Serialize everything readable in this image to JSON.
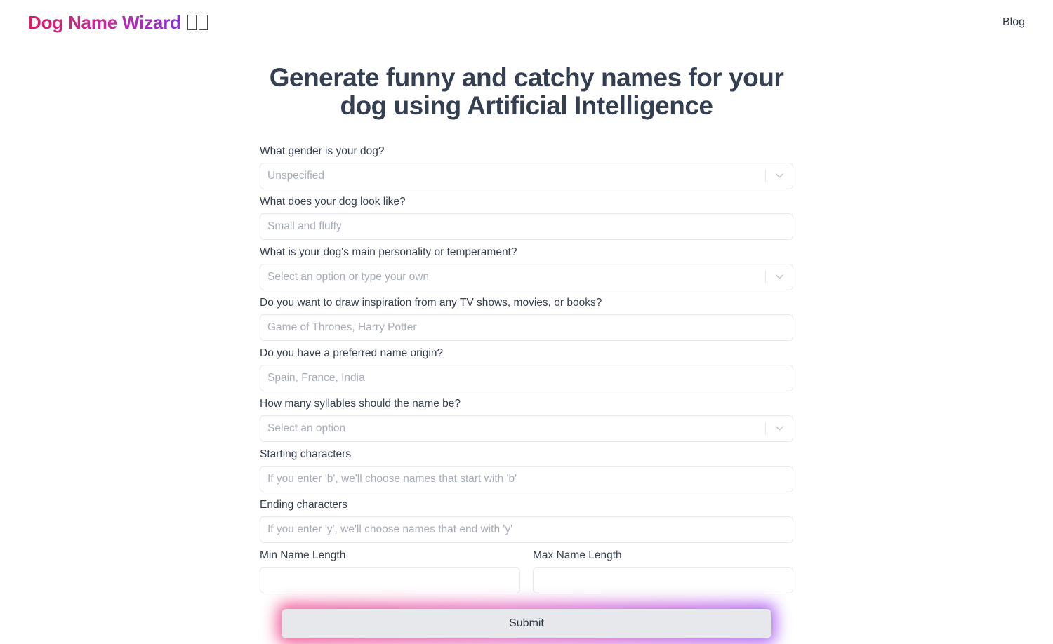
{
  "header": {
    "brand_text": "Dog Name Wizard",
    "brand_emoji_fallback": "░░",
    "nav": [
      {
        "label": "Blog"
      }
    ]
  },
  "main": {
    "title": "Generate funny and catchy names for your dog using Artificial Intelligence",
    "form": {
      "fields": [
        {
          "id": "gender",
          "label": "What gender is your dog?",
          "type": "select",
          "value": "Unspecified",
          "is_placeholder": true
        },
        {
          "id": "appearance",
          "label": "What does your dog look like?",
          "type": "text",
          "value": "",
          "placeholder": "Small and fluffy"
        },
        {
          "id": "personality",
          "label": "What is your dog's main personality or temperament?",
          "type": "select",
          "value": "Select an option or type your own",
          "is_placeholder": true
        },
        {
          "id": "inspiration",
          "label": "Do you want to draw inspiration from any TV shows, movies, or books?",
          "type": "text",
          "value": "",
          "placeholder": "Game of Thrones, Harry Potter"
        },
        {
          "id": "origin",
          "label": "Do you have a preferred name origin?",
          "type": "text",
          "value": "",
          "placeholder": "Spain, France, India"
        },
        {
          "id": "syllables",
          "label": "How many syllables should the name be?",
          "type": "select",
          "value": "Select an option",
          "is_placeholder": true
        },
        {
          "id": "starting_characters",
          "label": "Starting characters",
          "type": "text",
          "value": "",
          "placeholder": "If you enter 'b', we'll choose names that start with 'b'"
        },
        {
          "id": "ending_characters",
          "label": "Ending characters",
          "type": "text",
          "value": "",
          "placeholder": "If you enter 'y', we'll choose names that end with 'y'"
        }
      ],
      "length_row": {
        "min": {
          "label": "Min Name Length",
          "value": "",
          "placeholder": ""
        },
        "max": {
          "label": "Max Name Length",
          "value": "",
          "placeholder": ""
        }
      },
      "submit": {
        "label": "Submit"
      }
    }
  },
  "icons": {
    "chevron_down": "chevron-down-icon"
  },
  "colors": {
    "brand_gradient_start": "#d81b66",
    "brand_gradient_end": "#8b2fd6",
    "title": "#343f51",
    "label": "#333d4e",
    "placeholder": "#a8adb7",
    "input_border": "#e7e9ec",
    "page_background": "#ffffff",
    "submit_background": "#e6e8eb",
    "submit_glow_start": "#ec2f7a",
    "submit_glow_end": "#9b3ff0"
  }
}
